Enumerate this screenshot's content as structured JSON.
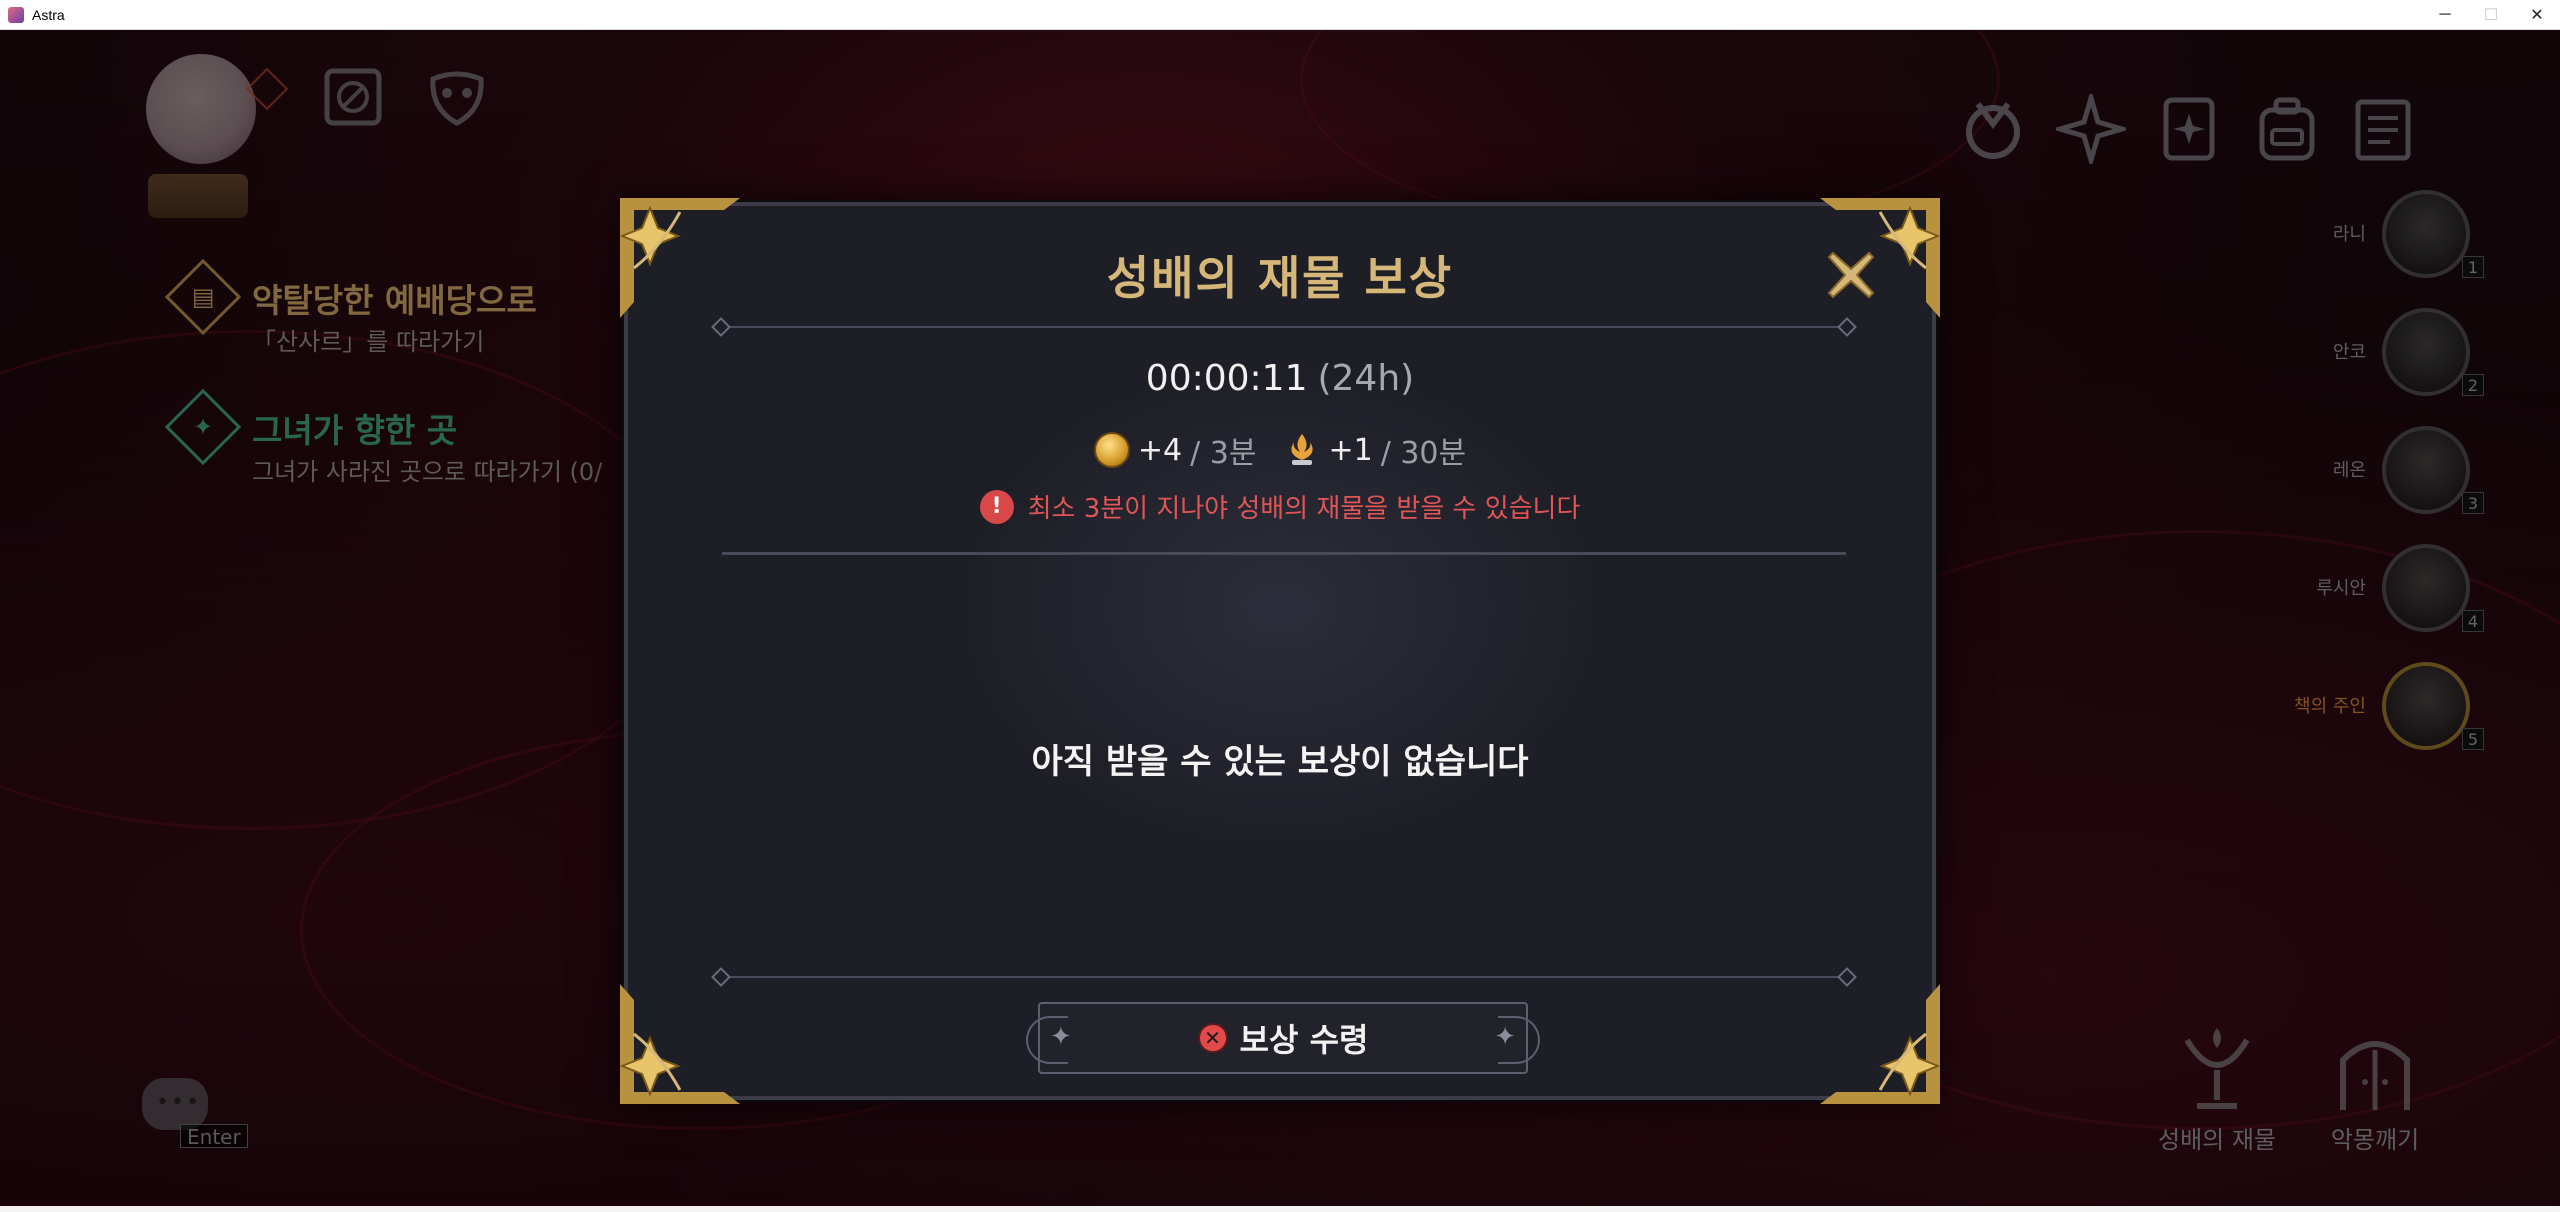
{
  "window": {
    "title": "Astra",
    "controls": {
      "minimize": "─",
      "maximize": "☐",
      "close": "✕"
    }
  },
  "hud": {
    "quests": [
      {
        "title": "약탈당한 예배당으로",
        "subtitle": "「산사르」를 따라가기",
        "color": "#c8a060",
        "icon": "book-icon"
      },
      {
        "title": "그녀가 향한 곳",
        "subtitle": "그녀가 사라진 곳으로 따라가기 (0/",
        "color": "#3f9d7a",
        "icon": "compass-star-icon"
      }
    ],
    "party": [
      {
        "name": "라니",
        "slot": "1"
      },
      {
        "name": "안코",
        "slot": "2"
      },
      {
        "name": "레온",
        "slot": "3"
      },
      {
        "name": "루시안",
        "slot": "4"
      },
      {
        "name": "책의 주인",
        "slot": "5"
      }
    ],
    "chat": {
      "dots": "•••",
      "enter_label": "Enter"
    },
    "bottom_menu": [
      {
        "label": "성배의 재물",
        "icon": "chalice-icon"
      },
      {
        "label": "악몽깨기",
        "icon": "gate-icon"
      }
    ]
  },
  "modal": {
    "title": "성배의 재물 보상",
    "timer": "00:00:11",
    "timer_suffix": "(24h)",
    "rates": [
      {
        "amount": "+4",
        "period": "/ 3분",
        "icon": "gold-coin-icon"
      },
      {
        "amount": "+1",
        "period": "/ 30분",
        "icon": "chalice-flame-icon"
      }
    ],
    "warning": "최소 3분이 지나야 성배의 재물을 받을 수 있습니다",
    "warning_icon": "!",
    "empty_message": "아직 받을 수 있는 보상이 없습니다",
    "claim_button": "보상 수령",
    "claim_key_hint": "✕"
  },
  "colors": {
    "gold": "#d6b77a",
    "warning": "#e05555",
    "panel": "#1e1e26"
  }
}
